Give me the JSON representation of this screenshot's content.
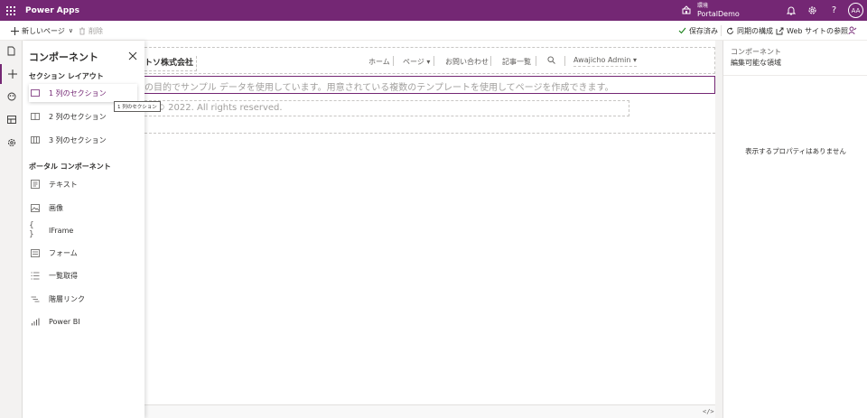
{
  "app": {
    "title": "Power Apps"
  },
  "environment": {
    "label": "環境",
    "name": "PortalDemo"
  },
  "user": {
    "initials": "AA"
  },
  "commandbar": {
    "new_page": "新しいページ",
    "delete": "削除",
    "saved": "保存済み",
    "sync": "同期の構成",
    "browse": "Web サイトの参照"
  },
  "components_panel": {
    "title": "コンポーネント",
    "section_layout_heading": "セクション レイアウト",
    "sections": [
      {
        "label": "1 列のセクション",
        "icon": "one-column-icon"
      },
      {
        "label": "2 列のセクション",
        "icon": "two-column-icon"
      },
      {
        "label": "3 列のセクション",
        "icon": "three-column-icon"
      }
    ],
    "tooltip": "1 列のセクション",
    "portal_heading": "ポータル コンポーネント",
    "portal_components": [
      {
        "label": "テキスト",
        "icon": "text-icon"
      },
      {
        "label": "画像",
        "icon": "image-icon"
      },
      {
        "label": "IFrame",
        "icon": "iframe-icon"
      },
      {
        "label": "フォーム",
        "icon": "form-icon"
      },
      {
        "label": "一覧取得",
        "icon": "list-icon"
      },
      {
        "label": "階層リンク",
        "icon": "breadcrumb-icon"
      },
      {
        "label": "Power BI",
        "icon": "powerbi-icon"
      }
    ]
  },
  "canvas": {
    "company": "トソ株式会社",
    "nav": [
      "ホーム",
      "ページ ▾",
      "お問い合わせ",
      "記事一覧"
    ],
    "user_menu": "Awajicho Admin ▾",
    "intro_text": "の目的でサンプル データを使用しています。用意されている複数のテンプレートを使用してページを作成できます。",
    "copyright": "© 2022. All rights reserved.",
    "code_view": "</>"
  },
  "properties": {
    "type": "コンポーネント",
    "name": "編集可能な領域",
    "empty": "表示するプロパティはありません"
  },
  "colors": {
    "brand": "#742774",
    "canvas": "#ffffff",
    "chrome": "#f3f2f1"
  }
}
